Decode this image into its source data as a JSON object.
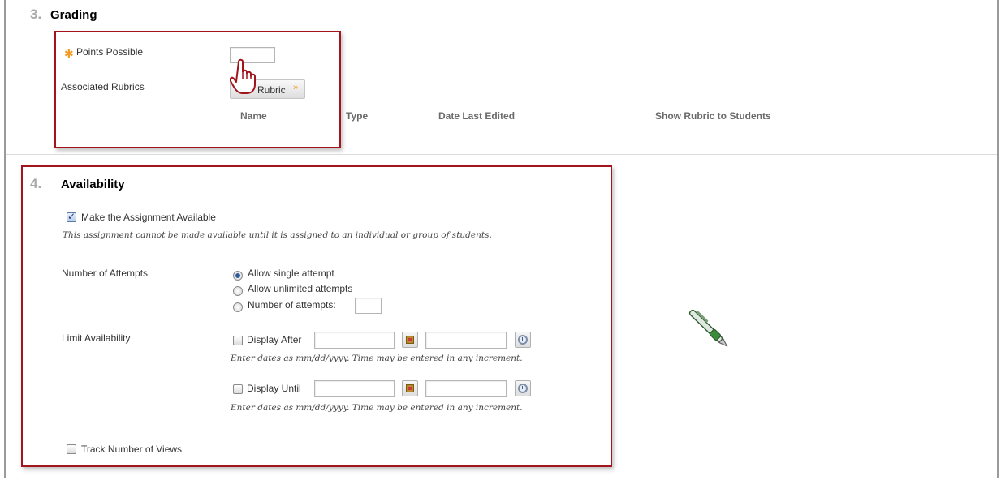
{
  "grading": {
    "step_number": "3.",
    "title": "Grading",
    "points_label": "Points Possible",
    "points_value": "",
    "rubrics_label": "Associated Rubrics",
    "rubric_button": "Rubric",
    "table_headers": [
      "Name",
      "Type",
      "Date Last Edited",
      "Show Rubric to Students"
    ]
  },
  "availability": {
    "step_number": "4.",
    "title": "Availability",
    "make_available_label": "Make the Assignment Available",
    "make_available_checked": true,
    "make_available_note": "This assignment cannot be made available until it is assigned to an individual or group of students.",
    "attempts_label": "Number of Attempts",
    "attempt_options": [
      "Allow single attempt",
      "Allow unlimited attempts",
      "Number of attempts:"
    ],
    "attempt_selected": "Allow single attempt",
    "attempts_count": "",
    "limit_label": "Limit Availability",
    "display_after_label": "Display After",
    "display_until_label": "Display Until",
    "date_hint": "Enter dates as mm/dd/yyyy. Time may be entered in any increment.",
    "track_views_label": "Track Number of Views"
  },
  "colors": {
    "highlight_border": "#a3151b",
    "required_star": "#f39a23"
  },
  "icons": {
    "required": "asterisk-icon",
    "cursor": "hand-pointer-icon",
    "dropdown": "double-chevron-down-icon",
    "calendar": "calendar-icon",
    "clock": "clock-icon",
    "annotation": "pen-icon"
  }
}
